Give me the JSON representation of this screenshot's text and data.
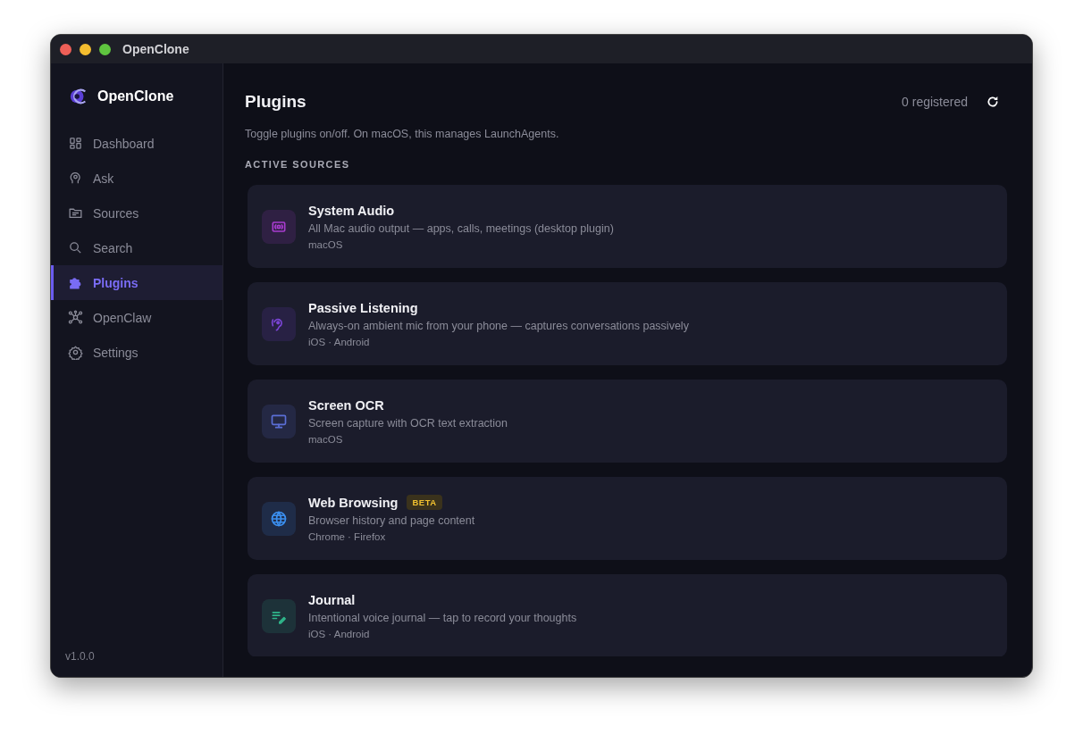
{
  "window": {
    "title": "OpenClone"
  },
  "sidebar": {
    "brand": "OpenClone",
    "items": [
      {
        "kind": "dashboard",
        "label": "Dashboard",
        "selected": false
      },
      {
        "kind": "ask",
        "label": "Ask",
        "selected": false
      },
      {
        "kind": "sources",
        "label": "Sources",
        "selected": false
      },
      {
        "kind": "search",
        "label": "Search",
        "selected": false
      },
      {
        "kind": "plugins",
        "label": "Plugins",
        "selected": true
      },
      {
        "kind": "network",
        "label": "OpenClaw",
        "selected": false
      },
      {
        "kind": "settings",
        "label": "Settings",
        "selected": false
      }
    ],
    "version": "v1.0.0"
  },
  "header": {
    "title": "Plugins",
    "count": "0 registered",
    "subtitle": "Toggle plugins on/off. On macOS, this manages LaunchAgents."
  },
  "section": {
    "title": "ACTIVE SOURCES",
    "plugins": [
      {
        "kind": "audio",
        "color": "#a83ccf",
        "name": "System Audio",
        "description": "All Mac audio output — apps, calls, meetings (desktop plugin)",
        "platforms": "macOS"
      },
      {
        "kind": "ear",
        "color": "#7b45d6",
        "name": "Passive Listening",
        "description": "Always-on ambient mic from your phone — captures conversations passively",
        "platforms": "iOS · Android"
      },
      {
        "kind": "monitor",
        "color": "#5b6fd6",
        "name": "Screen OCR",
        "description": "Screen capture with OCR text extraction",
        "platforms": "macOS"
      },
      {
        "kind": "globe",
        "color": "#3b8ff0",
        "name": "Web Browsing",
        "badge": "BETA",
        "description": "Browser history and page content",
        "platforms": "Chrome · Firefox"
      },
      {
        "kind": "journal",
        "color": "#2fb58a",
        "name": "Journal",
        "description": "Intentional voice journal — tap to record your thoughts",
        "platforms": "iOS · Android"
      }
    ]
  }
}
